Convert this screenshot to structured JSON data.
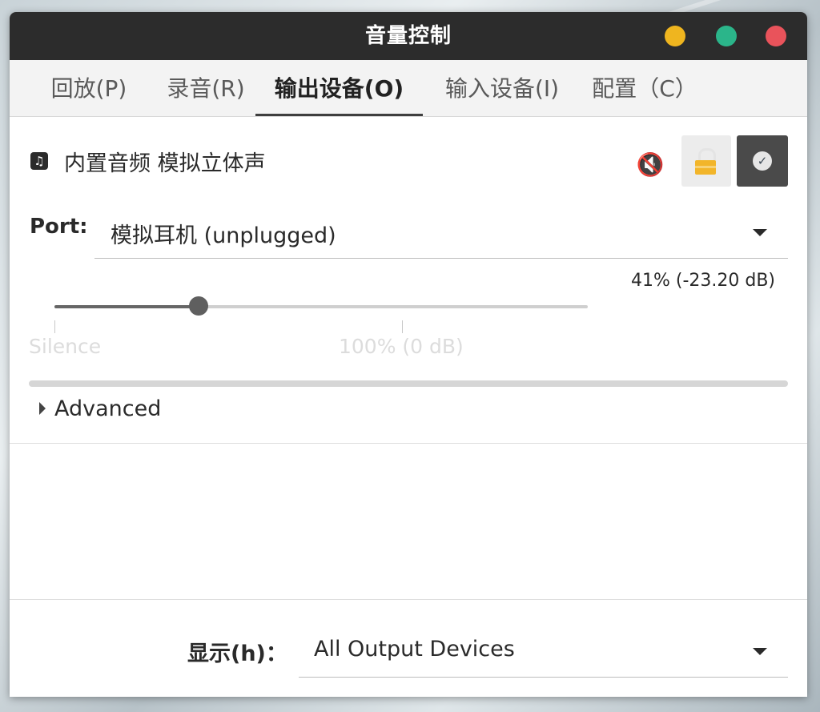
{
  "window": {
    "title": "音量控制",
    "controls": {
      "minimize_color": "#efb51f",
      "maximize_color": "#2bb58a",
      "close_color": "#e9535b"
    }
  },
  "tabs": [
    {
      "label": "回放(P)",
      "active": false
    },
    {
      "label": "录音(R)",
      "active": false
    },
    {
      "label": "输出设备(O)",
      "active": true
    },
    {
      "label": "输入设备(I)",
      "active": false
    },
    {
      "label": "配置（C）",
      "active": false
    }
  ],
  "device": {
    "icon": "music-note-icon",
    "name": "内置音频 模拟立体声",
    "mute_icon": "speaker-muted-icon",
    "lock_icon": "lock-icon",
    "default_icon": "checkmark-icon"
  },
  "port": {
    "label": "Port:",
    "value": "模拟耳机 (unplugged)"
  },
  "volume": {
    "readout": "41% (-23.20 dB)",
    "fraction_of_track": 0.27,
    "ticks": [
      {
        "label": "Silence"
      },
      {
        "label": "100% (0 dB)"
      }
    ]
  },
  "advanced": {
    "label": "Advanced"
  },
  "footer": {
    "show_label": "显示(h)：",
    "show_value": "All Output Devices"
  }
}
